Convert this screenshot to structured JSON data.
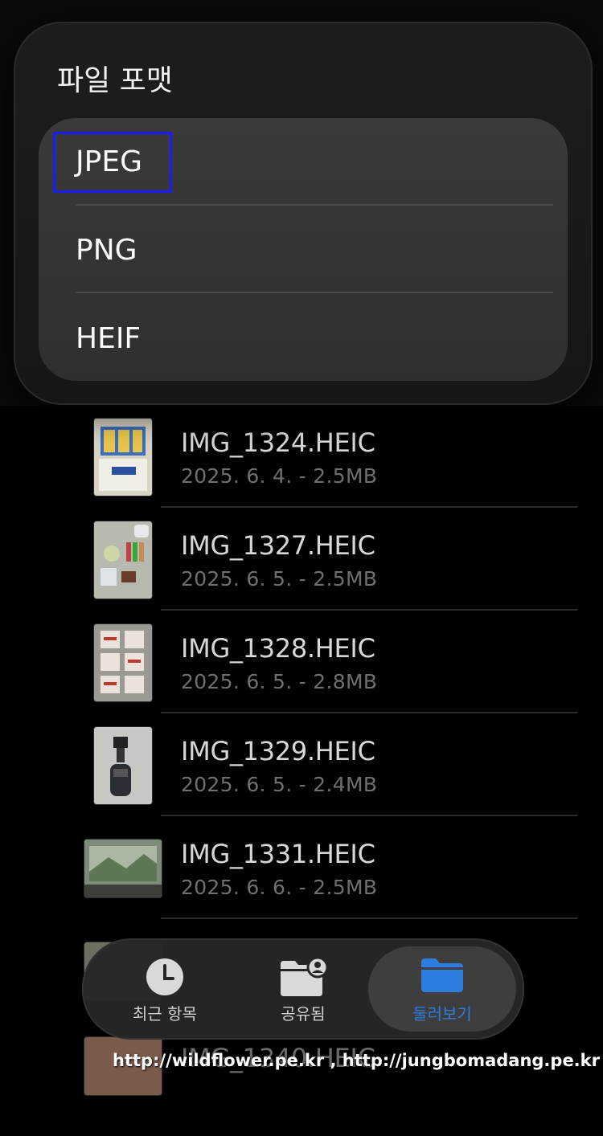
{
  "popover": {
    "title": "파일 포맷",
    "options": [
      {
        "label": "JPEG",
        "focused": true
      },
      {
        "label": "PNG",
        "focused": false
      },
      {
        "label": "HEIF",
        "focused": false
      }
    ]
  },
  "files": [
    {
      "name": "IMG_1324.HEIC",
      "meta": "2025. 6. 4. - 2.5MB"
    },
    {
      "name": "IMG_1327.HEIC",
      "meta": "2025. 6. 5. - 2.5MB"
    },
    {
      "name": "IMG_1328.HEIC",
      "meta": "2025. 6. 5. - 2.8MB"
    },
    {
      "name": "IMG_1329.HEIC",
      "meta": "2025. 6. 5. - 2.4MB"
    },
    {
      "name": "IMG_1331.HEIC",
      "meta": "2025. 6. 6. - 2.5MB"
    },
    {
      "name": "IMG_1340.HEIC",
      "meta": ""
    }
  ],
  "tabbar": {
    "recents": {
      "label": "최근 항목",
      "icon": "clock-icon"
    },
    "shared": {
      "label": "공유됨",
      "icon": "shared-folder-icon"
    },
    "browse": {
      "label": "둘러보기",
      "icon": "folder-icon",
      "active": true
    }
  },
  "watermark": "http://wildflower.pe.kr , http://jungbomadang.pe.kr",
  "colors": {
    "accent": "#2e7de0",
    "focus_ring": "#1a1aff"
  }
}
